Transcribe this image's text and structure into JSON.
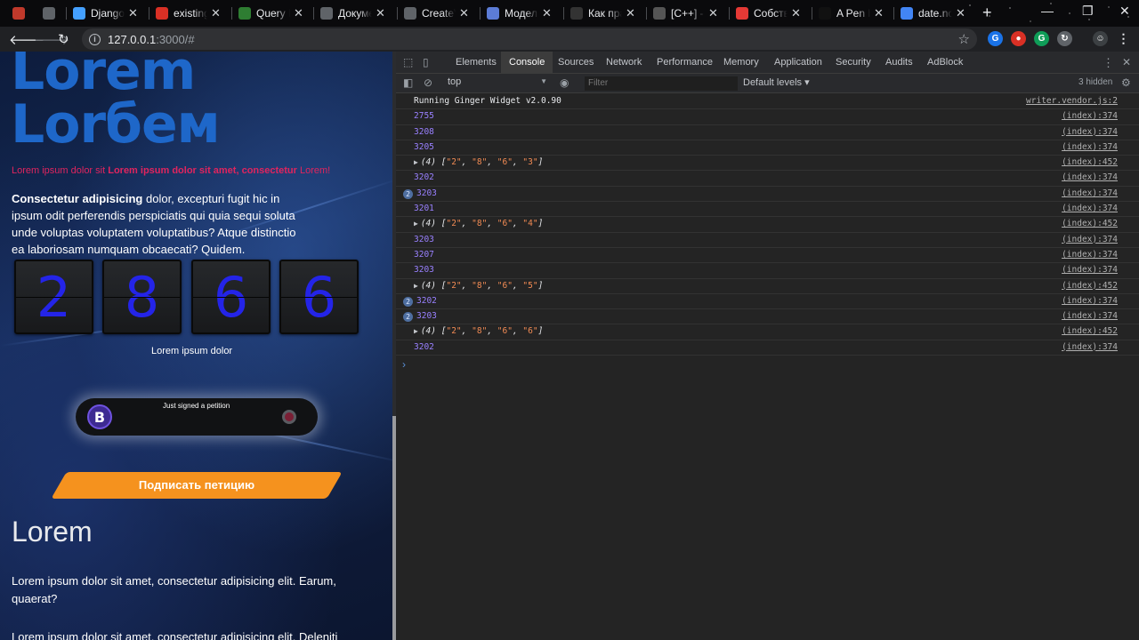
{
  "tabs": [
    {
      "title": "",
      "favicon_color": "#c0392b"
    },
    {
      "title": "",
      "favicon_color": "#5f6368"
    },
    {
      "title": "Django |",
      "favicon_color": "#44a0ff"
    },
    {
      "title": "existing",
      "favicon_color": "#d93025"
    },
    {
      "title": "Query Ex",
      "favicon_color": "#2e7d32"
    },
    {
      "title": "Докумен",
      "favicon_color": "#5f6368"
    },
    {
      "title": "CreateVi",
      "favicon_color": "#5f6368"
    },
    {
      "title": "Модели",
      "favicon_color": "#5c7cd6"
    },
    {
      "title": "Как прав",
      "favicon_color": "#333333"
    },
    {
      "title": "[C++] - F",
      "favicon_color": "#555555"
    },
    {
      "title": "Собстве",
      "favicon_color": "#e53935"
    },
    {
      "title": "A Pen by",
      "favicon_color": "#111111"
    },
    {
      "title": "date.now",
      "favicon_color": "#4285f4"
    }
  ],
  "address": {
    "host": "127.0.0.1",
    "path": ":3000/#"
  },
  "page": {
    "hero_line1": "Lorem",
    "hero_line2": "Lorбем",
    "subtitle_a": "Lorem ipsum dolor sit ",
    "subtitle_b": "Lorem ipsum dolor sit amet, consectetur",
    "subtitle_c": " Lorem!",
    "para_bold": "Consectetur adipisicing",
    "para_rest": " dolor, excepturi fugit hic in ipsum odit perferendis perspiciatis qui quia sequi soluta unde voluptas voluptatem voluptatibus? Atque distinctio ea laboriosam numquam obcaecati? Quidem.",
    "counter_digits": [
      "2",
      "8",
      "6",
      "6"
    ],
    "counter_caption": "Lorem ipsum dolor",
    "toast_avatar_letter": "B",
    "toast_text": "Just signed a petition",
    "cta_label": "Подписать петицию",
    "section_title": "Lorem",
    "section_p1": "Lorem ipsum dolor sit amet, consectetur adipisicing elit. Earum, quaerat?",
    "section_p2": "Lorem ipsum dolor sit amet, consectetur adipisicing elit. Deleniti"
  },
  "devtools": {
    "tabs": [
      "Elements",
      "Console",
      "Sources",
      "Network",
      "Performance",
      "Memory",
      "Application",
      "Security",
      "Audits",
      "AdBlock"
    ],
    "active_tab": "Console",
    "context": "top",
    "filter_placeholder": "Filter",
    "levels": "Default levels ▾",
    "hidden": "3 hidden",
    "console_rows": [
      {
        "type": "text",
        "text": "Running Ginger Widget v2.0.90",
        "source": "writer.vendor.js:2"
      },
      {
        "type": "num",
        "text": "2755",
        "source": "(index):374"
      },
      {
        "type": "num",
        "text": "3208",
        "source": "(index):374"
      },
      {
        "type": "num",
        "text": "3205",
        "source": "(index):374"
      },
      {
        "type": "arr",
        "prefix": "(4) ",
        "items": [
          "2",
          "8",
          "6",
          "3"
        ],
        "source": "(index):452"
      },
      {
        "type": "num",
        "text": "3202",
        "source": "(index):374"
      },
      {
        "type": "num",
        "text": "3203",
        "badge": "2",
        "source": "(index):374"
      },
      {
        "type": "num",
        "text": "3201",
        "source": "(index):374"
      },
      {
        "type": "arr",
        "prefix": "(4) ",
        "items": [
          "2",
          "8",
          "6",
          "4"
        ],
        "source": "(index):452"
      },
      {
        "type": "num",
        "text": "3203",
        "source": "(index):374"
      },
      {
        "type": "num",
        "text": "3207",
        "source": "(index):374"
      },
      {
        "type": "num",
        "text": "3203",
        "source": "(index):374"
      },
      {
        "type": "arr",
        "prefix": "(4) ",
        "items": [
          "2",
          "8",
          "6",
          "5"
        ],
        "source": "(index):452"
      },
      {
        "type": "num",
        "text": "3202",
        "badge": "2",
        "source": "(index):374"
      },
      {
        "type": "num",
        "text": "3203",
        "badge": "2",
        "source": "(index):374"
      },
      {
        "type": "arr",
        "prefix": "(4) ",
        "items": [
          "2",
          "8",
          "6",
          "6"
        ],
        "source": "(index):452"
      },
      {
        "type": "num",
        "text": "3202",
        "source": "(index):374"
      }
    ],
    "prompt_symbol": "›"
  }
}
